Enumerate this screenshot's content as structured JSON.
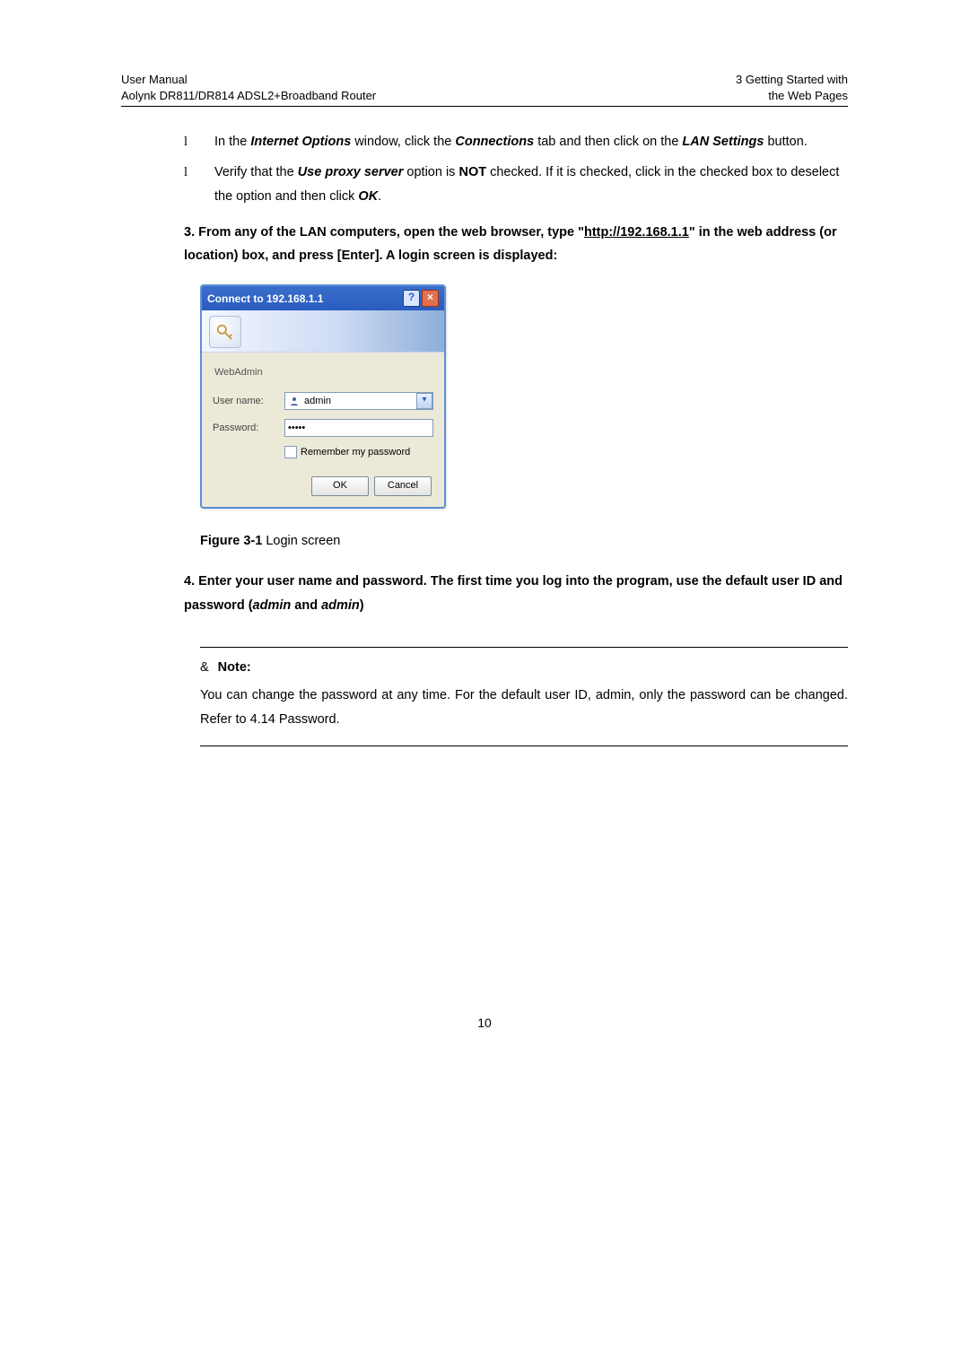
{
  "header": {
    "left_line1": "User Manual",
    "left_line2": "Aolynk DR811/DR814 ADSL2+Broadband Router",
    "right_line1": "3  Getting Started with",
    "right_line2": "the Web Pages"
  },
  "bullets": [
    {
      "mark": "l",
      "pre": "In the ",
      "b1": "Internet Options",
      "mid1": " window, click the ",
      "b2": "Connections",
      "mid2": " tab and then click on the ",
      "b3": "LAN Settings",
      "post": " button."
    },
    {
      "mark": "l",
      "pre": "Verify that the ",
      "b1": "Use proxy server",
      "mid1": " option is ",
      "b2": "NOT",
      "mid2": " checked. If it is checked, click in the checked box to deselect the option and then click ",
      "b3": "OK",
      "post": "."
    }
  ],
  "step3": {
    "pre": "3. From any of the LAN computers, open the web browser, type \"",
    "url": "http://192.168.1.1",
    "post": "\" in the web address (or location) box, and press [Enter]. A login screen is displayed:"
  },
  "dialog": {
    "title": "Connect to 192.168.1.1",
    "help": "?",
    "close": "×",
    "realm": "WebAdmin",
    "username_label": "User name:",
    "username_value": "admin",
    "password_label": "Password:",
    "password_value": "•••••",
    "remember_label": "Remember my password",
    "ok": "OK",
    "cancel": "Cancel"
  },
  "caption": {
    "num": "Figure 3-1",
    "text": " Login screen"
  },
  "step4": {
    "pre": "4. Enter your user name and password. The first time you log into the program, use the default user ID and password (",
    "i1": "admin",
    "mid": " and ",
    "i2": "admin",
    "post": ")"
  },
  "note": {
    "amp": "&",
    "label": "Note:",
    "body": "You can change the password at any time. For the default user ID, admin, only the password can be changed. Refer to 4.14  Password."
  },
  "page_number": "10"
}
